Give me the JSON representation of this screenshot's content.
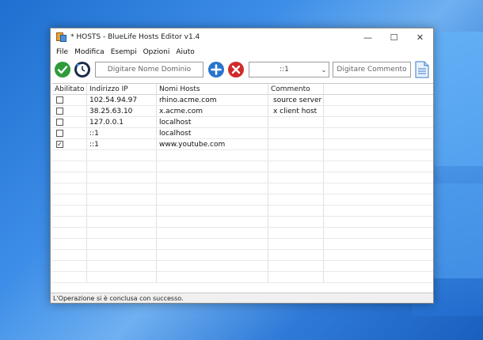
{
  "window": {
    "title": "* HOSTS - BlueLife Hosts Editor v1.4",
    "controls": {
      "minimize": "—",
      "maximize": "☐",
      "close": "✕"
    }
  },
  "menu": [
    "File",
    "Modifica",
    "Esempi",
    "Opzioni",
    "Aiuto"
  ],
  "toolbar": {
    "domain_placeholder": "Digitare Nome Dominio",
    "ip_selected": "::1",
    "comment_placeholder": "Digitare Commento",
    "icons": [
      "check-icon",
      "clock-icon",
      "add-icon",
      "delete-icon",
      "document-icon"
    ]
  },
  "table": {
    "columns": [
      "Abilitato",
      "Indirizzo IP",
      "Nomi Hosts",
      "Commento"
    ],
    "rows": [
      {
        "checked": false,
        "ip": "102.54.94.97",
        "host": "rhino.acme.com",
        "comment": "source server"
      },
      {
        "checked": false,
        "ip": "38.25.63.10",
        "host": "x.acme.com",
        "comment": "x client host"
      },
      {
        "checked": false,
        "ip": "127.0.0.1",
        "host": "localhost",
        "comment": ""
      },
      {
        "checked": false,
        "ip": "::1",
        "host": "localhost",
        "comment": ""
      },
      {
        "checked": true,
        "ip": "::1",
        "host": "www.youtube.com",
        "comment": ""
      }
    ]
  },
  "status": "L'Operazione si è conclusa con successo.",
  "colors": {
    "accent_green": "#2e9b3a",
    "accent_blue": "#2a74cf",
    "accent_red": "#d12a2a"
  }
}
